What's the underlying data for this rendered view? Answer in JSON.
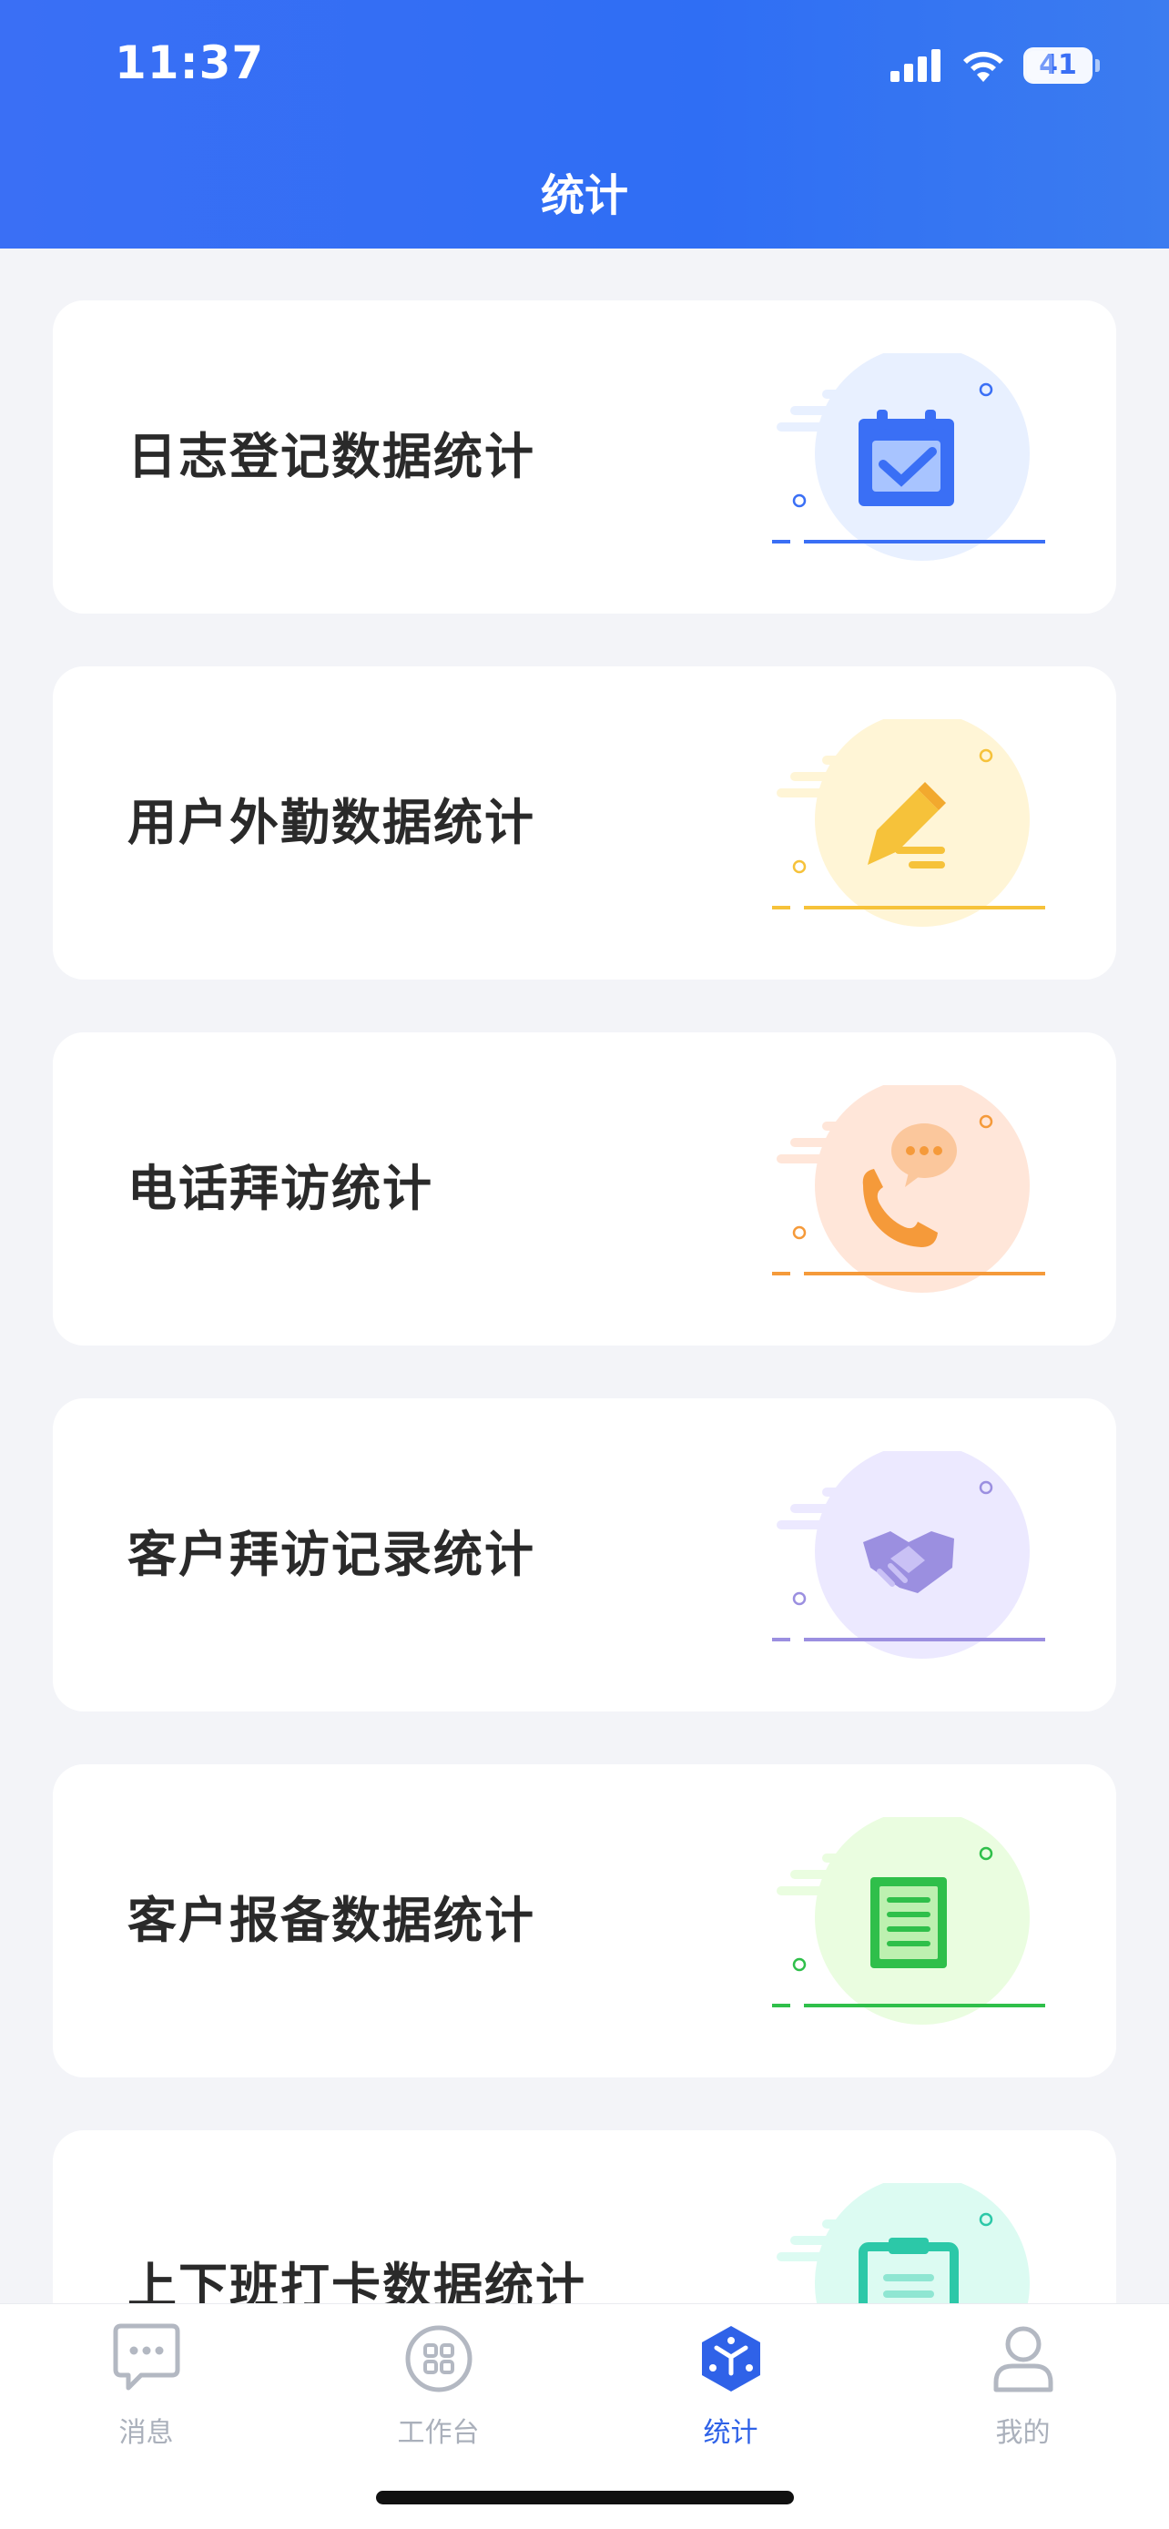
{
  "status_bar": {
    "time": "11:37",
    "battery": "41"
  },
  "header": {
    "title": "统计"
  },
  "cards": [
    {
      "label": "日志登记数据统计",
      "icon": "calendar-check-icon",
      "color": "#3a6ff5",
      "tint": "#e8f0ff"
    },
    {
      "label": "用户外勤数据统计",
      "icon": "pen-write-icon",
      "color": "#f6c23a",
      "tint": "#fff5d6"
    },
    {
      "label": "电话拜访统计",
      "icon": "phone-chat-icon",
      "color": "#f59a3a",
      "tint": "#ffe6d9"
    },
    {
      "label": "客户拜访记录统计",
      "icon": "handshake-icon",
      "color": "#9b8fe0",
      "tint": "#ece9ff"
    },
    {
      "label": "客户报备数据统计",
      "icon": "document-list-icon",
      "color": "#2fbf4a",
      "tint": "#eafde0"
    },
    {
      "label": "上下班打卡数据统计",
      "icon": "clipboard-icon",
      "color": "#2cc8a8",
      "tint": "#dcfbf2"
    }
  ],
  "tabbar": {
    "items": [
      {
        "label": "消息",
        "icon": "message-bubble-icon"
      },
      {
        "label": "工作台",
        "icon": "workbench-grid-icon"
      },
      {
        "label": "统计",
        "icon": "statistics-cube-icon",
        "active": true
      },
      {
        "label": "我的",
        "icon": "profile-person-icon"
      }
    ]
  }
}
